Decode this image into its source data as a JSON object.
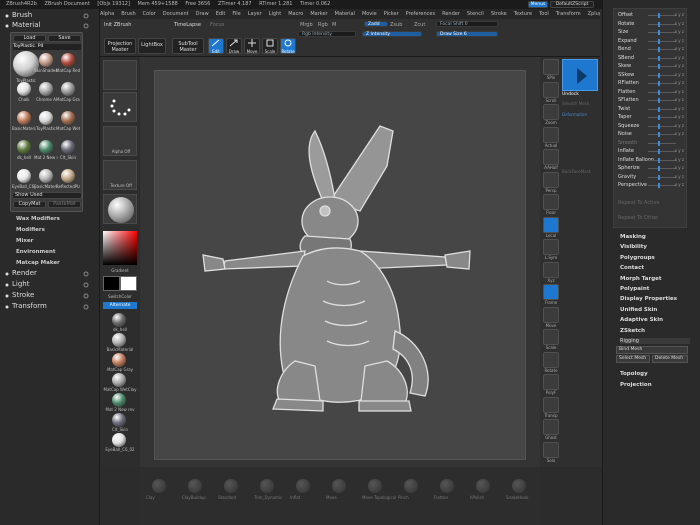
{
  "titlebar": {
    "app": "ZBrush4R2b",
    "document": "ZBrush Document",
    "objs": "[Objs 19312]",
    "mem": "Mem 459+1588",
    "free": "Free 3656",
    "ztime": "ZTimer 4.187",
    "rtime": "RTimer 1.281",
    "timer": "Timer 0.062",
    "menus_btn": "Menus",
    "script_btn": "DefaultZScript"
  },
  "topmenu": [
    "Alpha",
    "Brush",
    "Color",
    "Document",
    "Draw",
    "Edit",
    "File",
    "Layer",
    "Light",
    "Macro",
    "Marker",
    "Material",
    "Movie",
    "Picker",
    "Preferences",
    "Render",
    "Stencil",
    "Stroke",
    "Texture",
    "Tool",
    "Transform",
    "Zplugin",
    "Zscript"
  ],
  "toolbar": {
    "init": "Init ZBrush",
    "timelapse": "TimeLapse",
    "focus": "Focus",
    "projection_master": "Projection Master",
    "lightbox": "LightBox",
    "subtool_master": "SubTool Master",
    "edit": "Edit",
    "draw": "Draw",
    "move": "Move",
    "scale": "Scale",
    "rotate": "Rotate",
    "mrgb": "Mrgb",
    "rgb": "Rgb",
    "m": "M",
    "zadd": "Zadd",
    "zsub": "Zsub",
    "zcut": "Zcut",
    "rgb_intensity": "Rgb Intensity",
    "z_intensity": "Z Intensity",
    "focal_shift": "Focal Shift 0",
    "draw_size": "Draw Size 6"
  },
  "leftpanel": {
    "brush": "Brush",
    "material": "Material",
    "load": "Load",
    "save": "Save",
    "current_mat": "ToyPlastic. P4",
    "copymat": "CopyMat",
    "pastemat": "PasteMat",
    "show_used": "Show Used",
    "wax": "Wax Modifiers",
    "modifiers": "Modifiers",
    "mixer": "Mixer",
    "environment": "Environment",
    "matcap": "Matcap Maker",
    "render": "Render",
    "light": "Light",
    "stroke": "Stroke",
    "transform": "Transform",
    "materials": [
      {
        "name": "ToyPlastic",
        "color": "#d0d0d0"
      },
      {
        "name": "SkinShade4",
        "color": "#c49a86"
      },
      {
        "name": "MatCap Red Wax",
        "color": "#b24a3a"
      },
      {
        "name": "Chalk",
        "color": "#e0e0e0"
      },
      {
        "name": "Chrome A",
        "color": "#a8a8a8"
      },
      {
        "name": "MatCap Gray",
        "color": "#9a9a9a"
      },
      {
        "name": "BasicMaterial",
        "color": "#c07a5a"
      },
      {
        "name": "ToyPlastic",
        "color": "#d8d8d8"
      },
      {
        "name": "MatCap WetClay",
        "color": "#a46d4e"
      },
      {
        "name": "dk_hell",
        "color": "#5e7a3e"
      },
      {
        "name": "Mat 2 New rev",
        "color": "#4a8a6a"
      },
      {
        "name": "Clt_Skin",
        "color": "#6a6a7a"
      },
      {
        "name": "EyeBall_C6_02",
        "color": "#e8e8e8"
      },
      {
        "name": "BasicMaterial",
        "color": "#b8b8b8"
      },
      {
        "name": "ReflectedPlastic",
        "color": "#c4a888"
      }
    ]
  },
  "shelf": {
    "gradient": "Gradient",
    "switchcolor": "SwitchColor",
    "alternate": "Alternate",
    "materials": [
      {
        "name": "dk_hell",
        "color": "#6a6a6a"
      },
      {
        "name": "BasicMaterial",
        "color": "#b0b0b0"
      },
      {
        "name": "MatCap Gray",
        "color": "#c27a5a"
      },
      {
        "name": "MatCap WetClay",
        "color": "#a8a8a8"
      },
      {
        "name": "Mat 2 New rev",
        "color": "#4a8a6a"
      },
      {
        "name": "Clt_Skin",
        "color": "#6a6a7a"
      },
      {
        "name": "EyeBall_C6_02",
        "color": "#e0e0e0"
      }
    ],
    "thumb_labels": [
      "Alpha Off",
      "Texture Off"
    ]
  },
  "bottombar": {
    "brushes": [
      "Clay",
      "ClayBuildup",
      "Standard",
      "Trim_Dynamic",
      "Inflat",
      "Move",
      "Move Topological",
      "Pinch",
      "Flatten",
      "hPolish",
      "SnakeHook"
    ]
  },
  "rshelf": {
    "buttons": [
      "SPix",
      "Scroll",
      "Zoom",
      "Actual",
      "AAHalf",
      "Persp",
      "Floor",
      "Local",
      "L.Sym",
      "Xyz",
      "Frame",
      "Move",
      "Scale",
      "Rotate",
      "PolyF",
      "Transp",
      "Ghost",
      "Solo"
    ],
    "material_label": "Ghost",
    "tool_label": "Deformation",
    "subtool_label": "Undock",
    "smooth_label": "Smooth Mesh",
    "fill_label": "Fill",
    "backface": "BackFaceMask"
  },
  "rightpanel": {
    "deformations": [
      {
        "name": "Offset",
        "flags": "x y z"
      },
      {
        "name": "Rotate",
        "flags": "x y z"
      },
      {
        "name": "Size",
        "flags": "x y z"
      },
      {
        "name": "Expand",
        "flags": "x y z"
      },
      {
        "name": "Bend",
        "flags": "x y z"
      },
      {
        "name": "SBend",
        "flags": "x y z"
      },
      {
        "name": "Skew",
        "flags": "x y z"
      },
      {
        "name": "SSkew",
        "flags": "x y z"
      },
      {
        "name": "RFlatten",
        "flags": "x y z"
      },
      {
        "name": "Flatten",
        "flags": "x y z"
      },
      {
        "name": "SFlatten",
        "flags": "x y z"
      },
      {
        "name": "Twist",
        "flags": "x y z"
      },
      {
        "name": "Taper",
        "flags": "x y z"
      },
      {
        "name": "Squeeze",
        "flags": "x y z"
      },
      {
        "name": "Noise",
        "flags": "x y z"
      },
      {
        "name": "Smooth",
        "flags": ""
      },
      {
        "name": "Inflate",
        "flags": "x y z"
      },
      {
        "name": "Inflate Balloon",
        "flags": "x y z"
      },
      {
        "name": "Spherize",
        "flags": "x y z"
      },
      {
        "name": "Gravity",
        "flags": "x y z"
      },
      {
        "name": "Perspective",
        "flags": "x y z"
      }
    ],
    "repeat_active": "Repeat To Active",
    "repeat_other": "Repeat To Other",
    "items": [
      "Masking",
      "Visibility",
      "Polygroups",
      "Contact",
      "Morph Target",
      "Polypaint",
      "Display Properties",
      "Unified Skin",
      "Adaptive Skin",
      "ZSketch",
      "Rigging"
    ],
    "bind_mesh": "Bind Mesh",
    "select_mesh": "Select Mesh",
    "delete_mesh": "Delete Mesh",
    "topology": "Topology",
    "projection": "Projection"
  }
}
